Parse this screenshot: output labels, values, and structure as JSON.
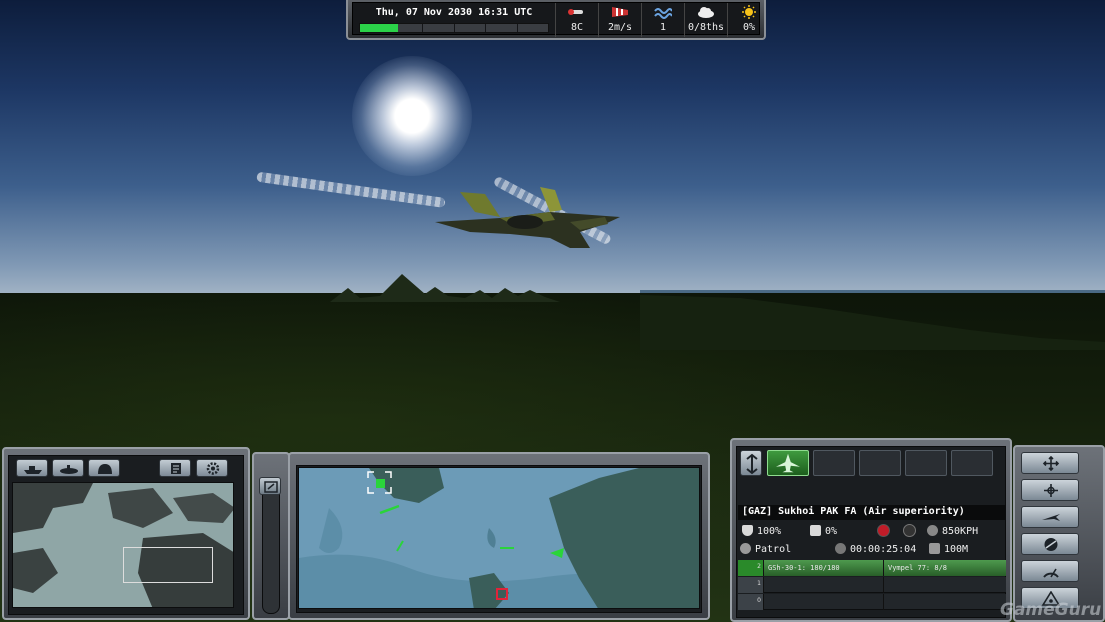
{
  "status_bar": {
    "datetime": "Thu, 07 Nov 2030 16:31 UTC",
    "time_progress_fraction": 0.2
  },
  "weather": {
    "temperature": "8C",
    "wind": "2m/s",
    "sea_state": "1",
    "cloud_cover": "0/8ths",
    "rain": "0%"
  },
  "unit": {
    "title": "[GAZ] Sukhoi PAK FA (Air superiority)",
    "damage": "100%",
    "fuel": "0%",
    "speed": "850KPH",
    "mission": "Patrol",
    "time": "00:00:25:04",
    "altitude": "100M"
  },
  "weapons": [
    {
      "tab": "2",
      "left": "GSh-30-1: 180/180",
      "right": "Vympel 77: 8/8",
      "active": true
    },
    {
      "tab": "1",
      "left": "",
      "right": "",
      "active": false
    },
    {
      "tab": "0",
      "left": "",
      "right": "",
      "active": false
    }
  ],
  "icons": {
    "left_panel": [
      "ship-icon",
      "submarine-icon",
      "aircraft-carrier-icon",
      "document-icon",
      "settings-icon"
    ],
    "right_panel": [
      "move-icon",
      "formation-icon",
      "aircraft-icon",
      "globe-icon",
      "radar-icon",
      "waypoint-icon"
    ]
  },
  "colors": {
    "accent_green": "#2bd249",
    "unit_friendly": "#2ad43a",
    "unit_hostile": "#e0243a",
    "map_water": "#6c9bb7",
    "map_land": "#3a5e5a"
  },
  "watermark": "GameGuru"
}
